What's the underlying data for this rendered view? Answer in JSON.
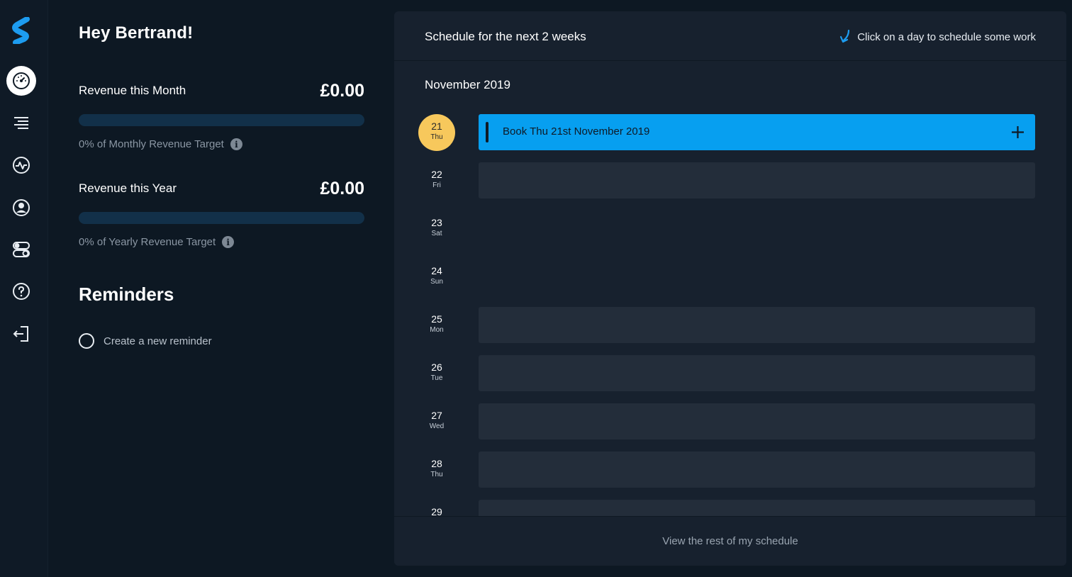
{
  "greeting": "Hey Bertrand!",
  "sidebar": {
    "logo": "s-logo",
    "items": [
      {
        "icon": "dashboard-icon",
        "active": true
      },
      {
        "icon": "list-icon"
      },
      {
        "icon": "activity-icon"
      },
      {
        "icon": "user-icon"
      },
      {
        "icon": "toggles-icon"
      },
      {
        "icon": "help-icon"
      },
      {
        "icon": "logout-icon"
      }
    ]
  },
  "revenue": {
    "month": {
      "label": "Revenue this Month",
      "value": "£0.00",
      "progress": 0,
      "target_text": "0% of Monthly Revenue Target"
    },
    "year": {
      "label": "Revenue this Year",
      "value": "£0.00",
      "progress": 0,
      "target_text": "0% of Yearly Revenue Target"
    }
  },
  "reminders": {
    "title": "Reminders",
    "create_label": "Create a new reminder"
  },
  "schedule": {
    "title": "Schedule for the next 2 weeks",
    "hint": "Click on a day to schedule some work",
    "month": "November 2019",
    "days": [
      {
        "num": "21",
        "name": "Thu",
        "today": true,
        "slot": "Book Thu 21st November 2019"
      },
      {
        "num": "22",
        "name": "Fri"
      },
      {
        "num": "23",
        "name": "Sat",
        "weekend": true
      },
      {
        "num": "24",
        "name": "Sun",
        "weekend": true
      },
      {
        "num": "25",
        "name": "Mon"
      },
      {
        "num": "26",
        "name": "Tue"
      },
      {
        "num": "27",
        "name": "Wed"
      },
      {
        "num": "28",
        "name": "Thu"
      },
      {
        "num": "29",
        "name": ""
      }
    ],
    "footer_link": "View the rest of my schedule"
  },
  "colors": {
    "accent": "#079ff0",
    "today": "#f7c85c",
    "background": "#0d1823",
    "panel": "#17212e"
  }
}
